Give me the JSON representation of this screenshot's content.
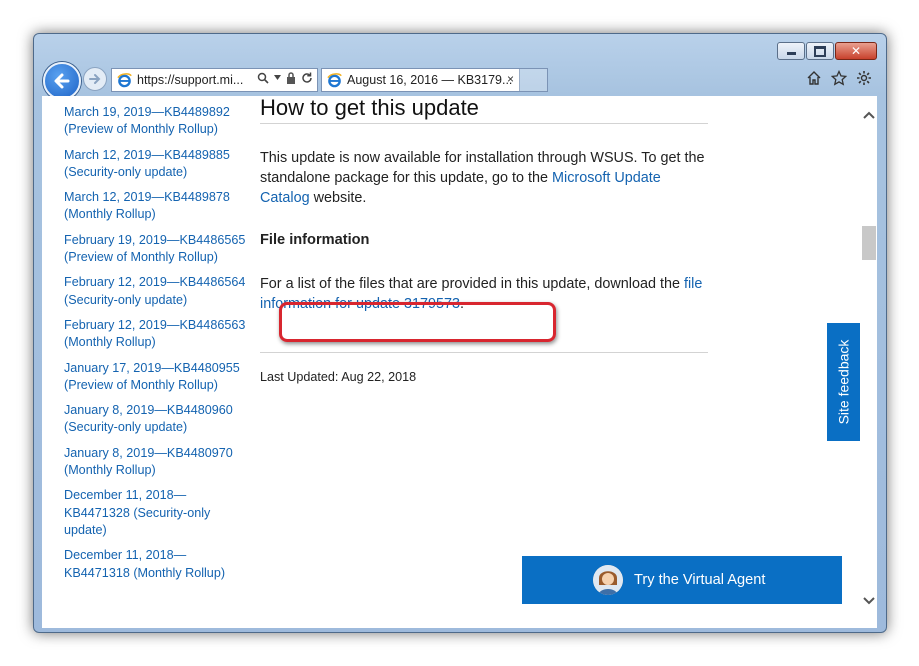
{
  "browser": {
    "address": "https://support.mi...",
    "tab_title": "August 16, 2016 — KB3179...",
    "tab_close": "×"
  },
  "sidebar": {
    "items": [
      {
        "label": "March 19, 2019—KB4489892 (Preview of Monthly Rollup)"
      },
      {
        "label": "March 12, 2019—KB4489885 (Security-only update)"
      },
      {
        "label": "March 12, 2019—KB4489878 (Monthly Rollup)"
      },
      {
        "label": "February 19, 2019—KB4486565 (Preview of Monthly Rollup)"
      },
      {
        "label": "February 12, 2019—KB4486564 (Security-only update)"
      },
      {
        "label": "February 12, 2019—KB4486563 (Monthly Rollup)"
      },
      {
        "label": "January 17, 2019—KB4480955 (Preview of Monthly Rollup)"
      },
      {
        "label": "January 8, 2019—KB4480960 (Security-only update)"
      },
      {
        "label": "January 8, 2019—KB4480970 (Monthly Rollup)"
      },
      {
        "label": "December 11, 2018—KB4471328 (Security-only update)"
      },
      {
        "label": "December 11, 2018—KB4471318 (Monthly Rollup)"
      }
    ]
  },
  "main": {
    "heading": "How to get this update",
    "para1_text": "This update is now available for installation through WSUS. To get the standalone package for this update, go to the ",
    "para1_link": "Microsoft Update Catalog",
    "para1_tail": " website.",
    "file_info_heading": "File information",
    "para2_text": "For a list of the files that are provided in this update, download the ",
    "para2_link": "file information for update 3179573",
    "para2_tail": ".",
    "last_updated": "Last Updated: Aug 22, 2018"
  },
  "feedback_label": "Site feedback",
  "agent_label": "Try the Virtual Agent",
  "colors": {
    "link": "#1463b0",
    "accent": "#0a6fc4",
    "highlight": "#d8262f"
  }
}
